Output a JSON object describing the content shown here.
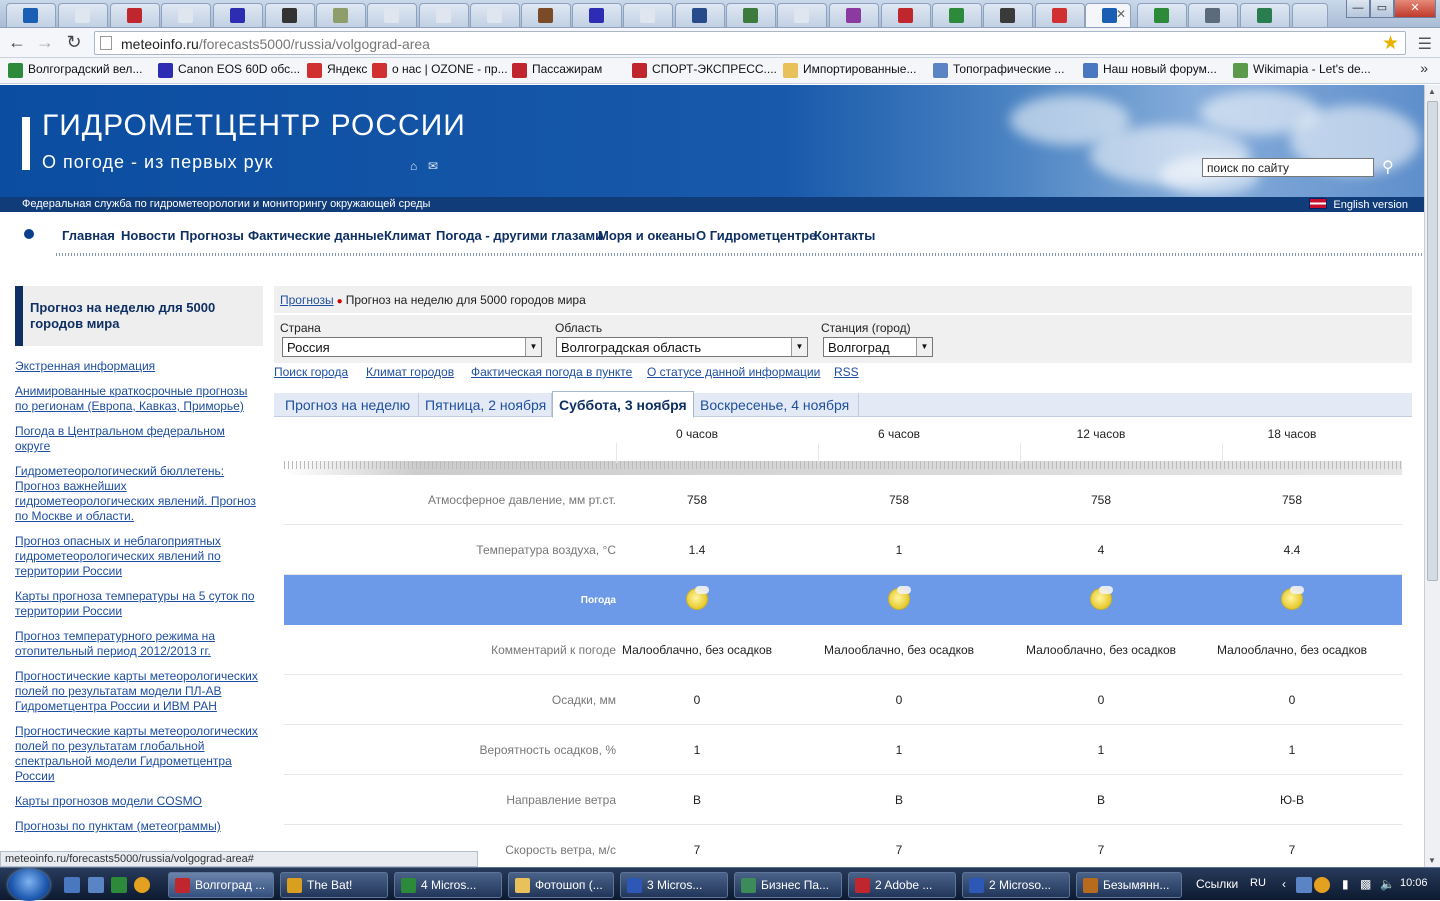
{
  "browser": {
    "url_host": "meteoinfo.ru",
    "url_path": "/forecasts5000/russia/volgograd-area",
    "window_buttons": [
      "—",
      "▭",
      "✕"
    ],
    "tab_colors": [
      "#1a5fb4",
      "#dfe6ef",
      "#c0262d",
      "#dfe6ef",
      "#2d2db3",
      "#333333",
      "#8e9e6a",
      "#dfe6ef",
      "#dfe6ef",
      "#dfe6ef",
      "#7a4b26",
      "#2d2db3",
      "#dfe6ef",
      "#274b8a",
      "#3d7a3d",
      "#dfe6ef",
      "#8a3aa0",
      "#c0262d",
      "#2c8a3a",
      "#3a3a3a",
      "#d03030",
      "#1a5fb4",
      "#2c8a3a",
      "#5b6b7c",
      "#2a7d4f"
    ],
    "bookmarks": [
      {
        "label": "Волгоградский вел...",
        "color": "#2c8a3a"
      },
      {
        "label": "Canon EOS 60D обс...",
        "color": "#2d2db3"
      },
      {
        "label": "Яндекс",
        "color": "#d03030"
      },
      {
        "label": "о нас | OZONE - пр...",
        "color": "#d03030"
      },
      {
        "label": "Пассажирам",
        "color": "#c0262d"
      },
      {
        "label": "СПОРТ-ЭКСПРЕСС....",
        "color": "#c0262d"
      },
      {
        "label": "Импортированные...",
        "color": "#e8c15a"
      },
      {
        "label": "Топографические ...",
        "color": "#5b84c4"
      },
      {
        "label": "Наш новый форум...",
        "color": "#4a78c0"
      },
      {
        "label": "Wikimapia - Let's de...",
        "color": "#5a9a4a"
      }
    ],
    "bookmarks_more": "»",
    "status_url": "meteoinfo.ru/forecasts5000/russia/volgograd-area#"
  },
  "header": {
    "title": "ГИДРОМЕТЦЕНТР РОССИИ",
    "slogan": "О погоде - из первых рук",
    "search_placeholder": "поиск по сайту",
    "subtitle": "Федеральная служба по гидрометеорологии и мониторингу окружающей среды",
    "english": "English version"
  },
  "nav": [
    "Главная",
    "Новости",
    "Прогнозы",
    "Фактические данные",
    "Климат",
    "Погода - другими глазами",
    "Моря и океаны",
    "О Гидрометцентре",
    "Контакты"
  ],
  "sidebar": {
    "title": "Прогноз на неделю для 5000 городов мира",
    "links": [
      "Экстренная информация",
      "Анимированные краткосрочные прогнозы по регионам (Европа, Кавказ, Приморье)",
      "Погода в Центральном федеральном округе",
      "Гидрометеорологический бюллетень: Прогноз важнейших гидрометеорологических явлений. Прогноз по Москве и области.",
      "Прогноз опасных и неблагоприятных гидрометеорологических явлений по территории России",
      "Карты прогноза температуры на 5 суток по территории России",
      "Прогноз температурного режима на отопительный период 2012/2013 гг.",
      "Прогностические карты метеорологических полей по результатам модели ПЛ-АВ Гидрометцентра России и ИВМ РАН",
      "Прогностические карты метеорологических полей по результатам глобальной спектральной модели Гидрометцентра России",
      "Карты прогнозов модели COSMO",
      "Прогнозы по пунктам (метеограммы)"
    ]
  },
  "content": {
    "breadcrumb_link": "Прогнозы",
    "breadcrumb_current": "Прогноз на неделю для 5000 городов мира",
    "country_label": "Страна",
    "country_value": "Россия",
    "region_label": "Область",
    "region_value": "Волгоградская область",
    "station_label": "Станция (город)",
    "station_value": "Волгоград",
    "links": [
      "Поиск города",
      "Климат городов",
      "Фактическая погода в пункте",
      "О статусе данной информации",
      "RSS"
    ],
    "tabs": [
      "Прогноз на неделю",
      "Пятница, 2 ноября",
      "Суббота, 3 ноября",
      "Воскресенье, 4 ноября"
    ],
    "active_tab": "Суббота, 3 ноября",
    "hours": [
      "0 часов",
      "6 часов",
      "12 часов",
      "18 часов"
    ],
    "rows": [
      {
        "label": "Атмосферное давление, мм рт.ст.",
        "values": [
          "758",
          "758",
          "758",
          "758"
        ]
      },
      {
        "label": "Температура воздуха, °C",
        "values": [
          "1.4",
          "1",
          "4",
          "4.4"
        ]
      },
      {
        "label": "Погода",
        "values": [
          "sun-cloud-icon",
          "sun-cloud-icon",
          "sun-cloud-icon",
          "sun-cloud-icon"
        ]
      },
      {
        "label": "Комментарий к погоде",
        "values": [
          "Малооблачно, без осадков",
          "Малооблачно, без осадков",
          "Малооблачно, без осадков",
          "Малооблачно, без осадков"
        ]
      },
      {
        "label": "Осадки, мм",
        "values": [
          "0",
          "0",
          "0",
          "0"
        ]
      },
      {
        "label": "Вероятность осадков, %",
        "values": [
          "1",
          "1",
          "1",
          "1"
        ]
      },
      {
        "label": "Направление ветра",
        "values": [
          "В",
          "В",
          "В",
          "Ю-В"
        ]
      },
      {
        "label": "Скорость ветра, м/с",
        "values": [
          "7",
          "7",
          "7",
          "7"
        ]
      }
    ]
  },
  "taskbar": {
    "items": [
      {
        "label": "Волгоград ...",
        "color": "#c0262d"
      },
      {
        "label": "The Bat!",
        "color": "#d8a01e"
      },
      {
        "label": "4 Micros...",
        "color": "#2c8a3a"
      },
      {
        "label": "Фотошоп (...",
        "color": "#e8c15a"
      },
      {
        "label": "3 Micros...",
        "color": "#2d58b8"
      },
      {
        "label": "Бизнес Па...",
        "color": "#3d8a5a"
      },
      {
        "label": "2 Adobe ...",
        "color": "#c0262d"
      },
      {
        "label": "2 Microso...",
        "color": "#2d58b8"
      },
      {
        "label": "Безымянн...",
        "color": "#b86a1f"
      }
    ],
    "links_label": "Ссылки",
    "lang": "RU",
    "clock": "10:06"
  }
}
